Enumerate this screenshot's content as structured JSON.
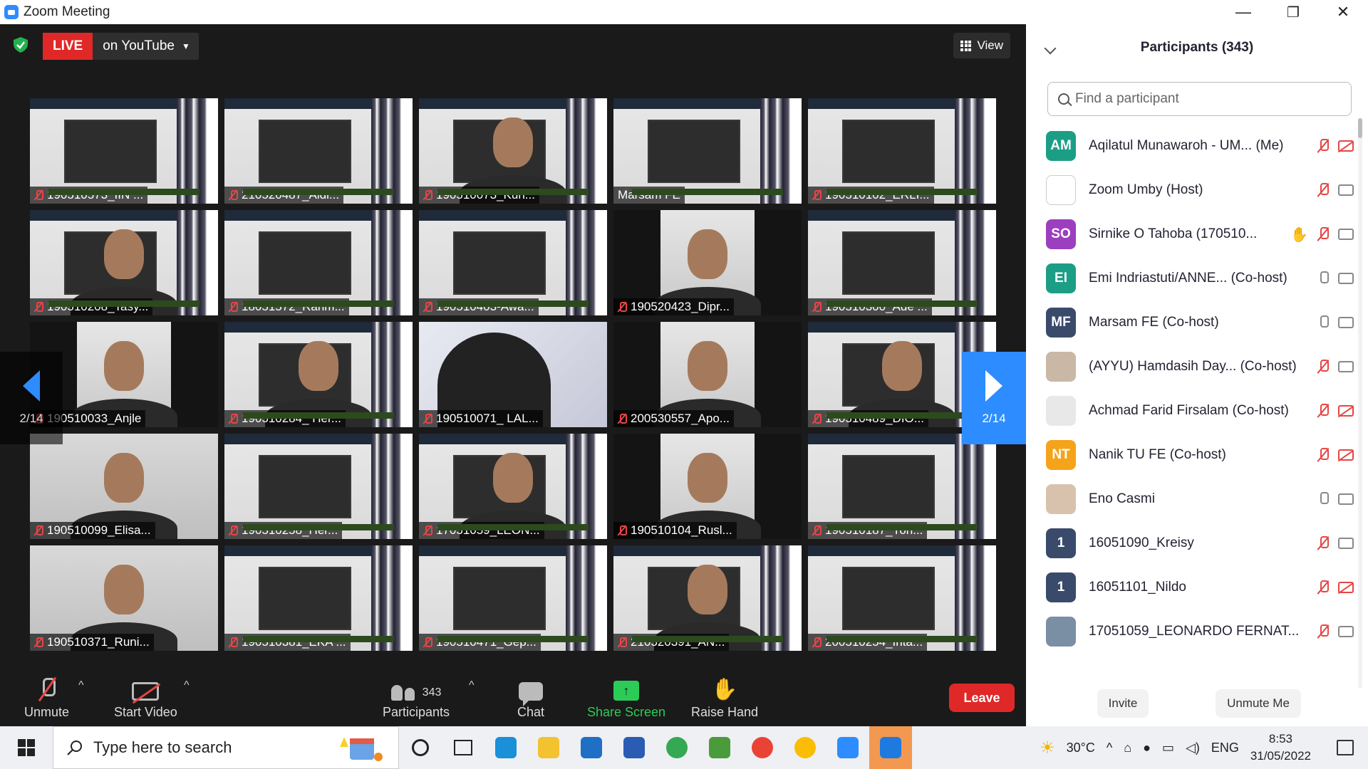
{
  "window": {
    "title": "Zoom Meeting",
    "minimize": "—",
    "restore": "❐",
    "close": "✕"
  },
  "meeting": {
    "live_label": "LIVE",
    "stream_label": "on YouTube",
    "view_label": "View",
    "page_indicator": "2/14",
    "tiles": [
      {
        "name": "190510573_IIN ...",
        "bg": "room",
        "muted": true
      },
      {
        "name": "210520487_Aldi...",
        "bg": "room",
        "muted": true
      },
      {
        "name": "190510073_Kun...",
        "bg": "room",
        "muted": true
      },
      {
        "name": "Marsam FE",
        "bg": "room",
        "muted": false
      },
      {
        "name": "190510102_ERLI...",
        "bg": "room",
        "muted": true
      },
      {
        "name": "190510208_Tasy...",
        "bg": "room",
        "muted": true
      },
      {
        "name": "18051572_Rahm...",
        "bg": "room",
        "muted": true
      },
      {
        "name": "190510403-Awa...",
        "bg": "room",
        "muted": true
      },
      {
        "name": "190520423_Dipr...",
        "bg": "dark",
        "muted": true
      },
      {
        "name": "190510300_Ade ...",
        "bg": "room",
        "muted": true
      },
      {
        "name": "190510033_Anjle",
        "bg": "dark",
        "muted": true
      },
      {
        "name": "190510284_ Her...",
        "bg": "room",
        "muted": true
      },
      {
        "name": "190510071_ LAL...",
        "bg": "blurry",
        "muted": true
      },
      {
        "name": "200530557_Apo...",
        "bg": "dark",
        "muted": true
      },
      {
        "name": "190510489_DIO...",
        "bg": "room",
        "muted": true
      },
      {
        "name": "190510099_Elisa...",
        "bg": "person",
        "muted": true
      },
      {
        "name": "190510258_Her...",
        "bg": "room",
        "muted": true
      },
      {
        "name": "17051059_LEON...",
        "bg": "room",
        "muted": true
      },
      {
        "name": "190510104_Rusl...",
        "bg": "dark",
        "muted": true
      },
      {
        "name": "190510187_Yon...",
        "bg": "room",
        "muted": true
      },
      {
        "name": "190510371_Runi...",
        "bg": "person",
        "muted": true
      },
      {
        "name": "190510381_EKA ...",
        "bg": "room",
        "muted": true
      },
      {
        "name": "190510471_Gep...",
        "bg": "room",
        "muted": true
      },
      {
        "name": "210520391_AN...",
        "bg": "room",
        "muted": true
      },
      {
        "name": "200510254_Inta...",
        "bg": "room",
        "muted": true
      }
    ]
  },
  "toolbar": {
    "unmute": "Unmute",
    "start_video": "Start Video",
    "participants": "Participants",
    "participants_count": "343",
    "chat": "Chat",
    "share_screen": "Share Screen",
    "raise_hand": "Raise Hand",
    "leave": "Leave"
  },
  "panel": {
    "title": "Participants (343)",
    "search_placeholder": "Find a participant",
    "invite": "Invite",
    "unmute_me": "Unmute Me",
    "participants": [
      {
        "initials": "AM",
        "color": "#1c9e86",
        "name": "Aqilatul Munawaroh - UM...",
        "role": "(Me)",
        "mic": "muted",
        "cam": "off",
        "hand": false
      },
      {
        "initials": "",
        "color": "#ffffff",
        "name": "Zoom Umby",
        "role": "(Host)",
        "mic": "muted",
        "cam": "on",
        "hand": false,
        "logo": true
      },
      {
        "initials": "SO",
        "color": "#9b3fbf",
        "name": "Sirnike  O   Tahoba (170510...",
        "role": "",
        "mic": "muted",
        "cam": "on",
        "hand": true
      },
      {
        "initials": "EI",
        "color": "#1c9e86",
        "name": "Emi Indriastuti/ANNE...",
        "role": "(Co-host)",
        "mic": "on",
        "cam": "on",
        "hand": false
      },
      {
        "initials": "MF",
        "color": "#3a4a6b",
        "name": "Marsam FE",
        "role": "(Co-host)",
        "mic": "on",
        "cam": "on",
        "hand": false
      },
      {
        "initials": "",
        "color": "#c9b8a6",
        "name": "(AYYU) Hamdasih Day...",
        "role": "(Co-host)",
        "mic": "muted",
        "cam": "on",
        "hand": false
      },
      {
        "initials": "",
        "color": "#e8e8e8",
        "name": "Achmad Farid Firsalam",
        "role": "(Co-host)",
        "mic": "muted",
        "cam": "off",
        "hand": false
      },
      {
        "initials": "NT",
        "color": "#f5a31a",
        "name": "Nanik TU FE",
        "role": "(Co-host)",
        "mic": "muted",
        "cam": "off",
        "hand": false
      },
      {
        "initials": "",
        "color": "#d9c2ad",
        "name": "Eno Casmi",
        "role": "",
        "mic": "on",
        "cam": "on",
        "hand": false
      },
      {
        "initials": "1",
        "color": "#3a4a6b",
        "name": "16051090_Kreisy",
        "role": "",
        "mic": "muted",
        "cam": "on",
        "hand": false
      },
      {
        "initials": "1",
        "color": "#3a4a6b",
        "name": "16051101_Nildo",
        "role": "",
        "mic": "muted",
        "cam": "off",
        "hand": false
      },
      {
        "initials": "",
        "color": "#7a8fa3",
        "name": "17051059_LEONARDO FERNAT...",
        "role": "",
        "mic": "muted",
        "cam": "on",
        "hand": false
      }
    ]
  },
  "taskbar": {
    "search_placeholder": "Type here to search",
    "weather": "30°C",
    "language": "ENG",
    "time": "8:53",
    "date": "31/05/2022",
    "apps": [
      {
        "name": "edge-icon",
        "color": "#1b8fd8"
      },
      {
        "name": "file-explorer-icon",
        "color": "#f2c230"
      },
      {
        "name": "mail-icon",
        "color": "#1f6fc4"
      },
      {
        "name": "word-icon",
        "color": "#2b5cb3"
      },
      {
        "name": "chrome-icon",
        "color": "#34a853"
      },
      {
        "name": "leaf-app-icon",
        "color": "#4a9b3a"
      },
      {
        "name": "chrome-icon-2",
        "color": "#ea4335"
      },
      {
        "name": "chrome-icon-3",
        "color": "#fbbc05"
      },
      {
        "name": "zoom-icon",
        "color": "#2d8cff"
      },
      {
        "name": "screen-recorder-icon",
        "color": "#1f7ae0"
      }
    ]
  }
}
